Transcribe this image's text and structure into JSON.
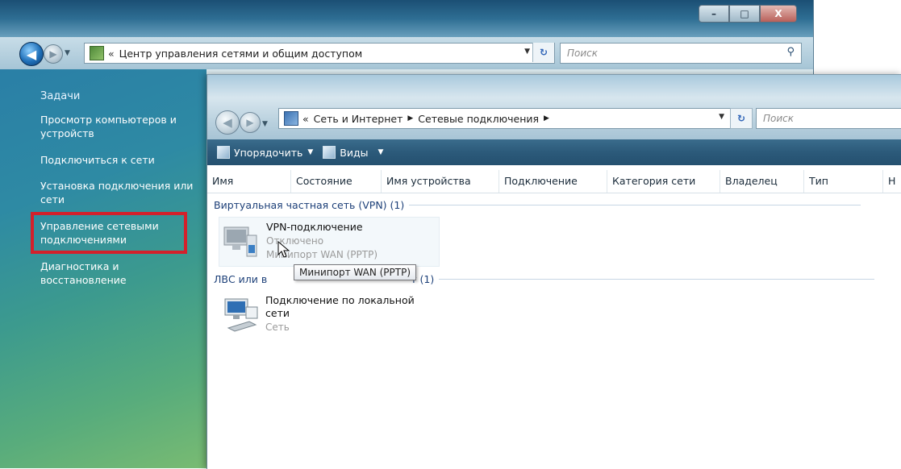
{
  "back_window": {
    "address": {
      "chevron": "«",
      "path": "Центр управления сетями и общим доступом"
    },
    "search_placeholder": "Поиск",
    "refresh_glyph": "⁴⁄₇",
    "window_controls": {
      "minimize": "–",
      "maximize": "□",
      "close": "X"
    },
    "task_pane": {
      "title": "Задачи",
      "links": [
        "Просмотр компьютеров и устройств",
        "Подключиться к сети",
        "Установка подключения или сети",
        "Управление сетевыми подключениями",
        "Диагностика и восстановление"
      ]
    },
    "highlight_color": "#d3202b"
  },
  "front_window": {
    "address": {
      "chevron": "«",
      "crumbs": [
        "Сеть и Интернет",
        "Сетевые подключения"
      ]
    },
    "search_placeholder": "Поиск",
    "toolbar": {
      "organize": "Упорядочить",
      "views": "Виды"
    },
    "columns": [
      "Имя",
      "Состояние",
      "Имя устройства",
      "Подключение",
      "Категория сети",
      "Владелец",
      "Тип",
      "Н"
    ],
    "groups": [
      {
        "label": "Виртуальная частная сеть (VPN) (1)",
        "items": [
          {
            "name": "VPN-подключение",
            "status": "Отключено",
            "device": "Минипорт WAN (PPTP)"
          }
        ]
      },
      {
        "label_visible": "ЛВС или в",
        "label_suffix": "т (1)",
        "items": [
          {
            "name_line1": "Подключение по локальной",
            "name_line2": "сети",
            "status": "Сеть"
          }
        ]
      }
    ],
    "tooltip": "Минипорт WAN (PPTP)"
  }
}
